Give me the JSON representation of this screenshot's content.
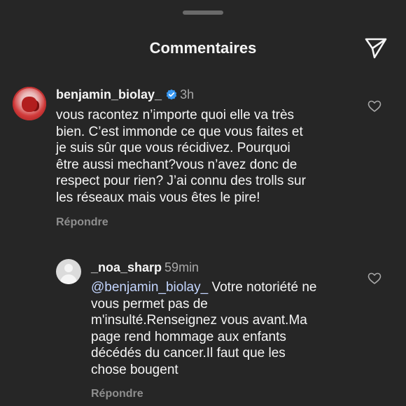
{
  "header": {
    "title": "Commentaires"
  },
  "comments": [
    {
      "username": "benjamin_biolay_",
      "verified": true,
      "time": "3h",
      "lines": [
        "vous racontez n’importe quoi elle va très",
        "bien. C’est immonde ce que vous faites et",
        "je suis sûr que vous récidivez. Pourquoi",
        "être aussi mechant?vous n’avez donc de",
        "respect pour rien? J’ai connu des trolls sur",
        "les réseaux mais vous êtes le pire!"
      ],
      "reply_label": "Répondre"
    },
    {
      "username": "_noa_sharp",
      "verified": false,
      "time": "59min",
      "mention": "@benjamin_biolay_",
      "lines": [
        " Votre notoriété ne",
        "vous permet pas de",
        "m'insulté.Renseignez vous avant.Ma",
        "page rend hommage aux enfants",
        "décédés du cancer.Il faut que les",
        "chose bougent"
      ],
      "reply_label": "Répondre"
    }
  ],
  "icons": {
    "share": "paper-plane-icon",
    "like": "heart-outline-icon",
    "verified": "verified-badge-icon"
  },
  "colors": {
    "background": "#262626",
    "verified": "#3897f0",
    "mention": "#c4d6ff",
    "muted": "#8e8e8e"
  }
}
